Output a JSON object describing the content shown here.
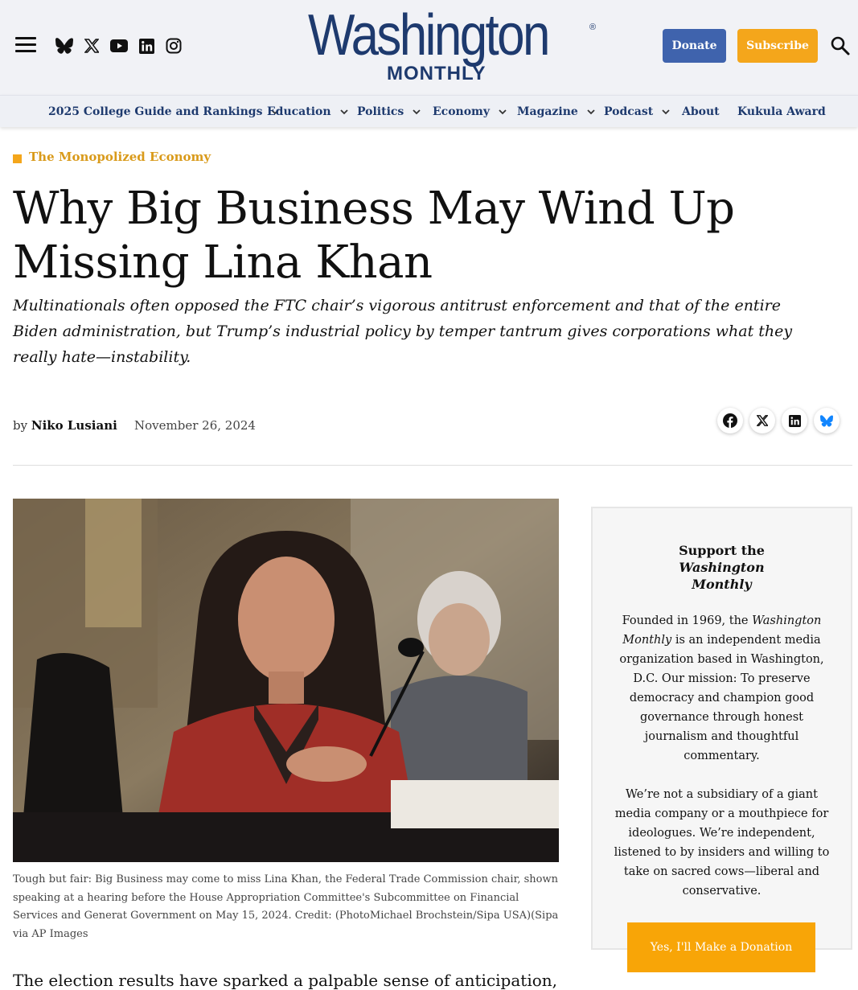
{
  "header": {
    "menu_icon": "hamburger-menu-icon",
    "social_icons": [
      "bluesky-icon",
      "x-icon",
      "youtube-icon",
      "linkedin-icon",
      "instagram-icon"
    ],
    "logo_text": "Washington",
    "logo_reg": "®",
    "logo_sub": "MONTHLY",
    "donate_label": "Donate",
    "subscribe_label": "Subscribe",
    "search_icon": "search-icon"
  },
  "nav": {
    "items": [
      {
        "label": "2025 College Guide and Rankings",
        "has_dropdown": true
      },
      {
        "label": "Education",
        "has_dropdown": true
      },
      {
        "label": "Politics",
        "has_dropdown": true
      },
      {
        "label": "Economy",
        "has_dropdown": true
      },
      {
        "label": "Magazine",
        "has_dropdown": true
      },
      {
        "label": "Podcast",
        "has_dropdown": true
      },
      {
        "label": "About",
        "has_dropdown": false
      },
      {
        "label": "Kukula Award",
        "has_dropdown": false
      }
    ]
  },
  "article": {
    "category": "The Monopolized Economy",
    "title": "Why Big Business May Wind Up Missing Lina Khan",
    "dek": "Multinationals often opposed the FTC chair’s vigorous antitrust enforcement and that of the entire Biden administration, but Trump’s industrial policy by temper tantrum gives corporations what they really hate—instability.",
    "by_prefix": "by",
    "author": "Niko Lusiani",
    "date": "November 26, 2024",
    "share_icons": [
      "facebook-icon",
      "x-icon",
      "linkedin-icon",
      "bluesky-icon"
    ],
    "caption": "Tough but fair: Big Business may come to miss Lina Khan, the Federal Trade Commission chair, shown speaking at a hearing before the House Appropriation Committee's Subcommittee on Financial Services and Generat Government on May 15, 2024. Credit: (PhotoMichael Brochstein/Sipa USA)(Sipa via AP Images",
    "body_start": "The election results have sparked a palpable sense of anticipation, if"
  },
  "sidebar": {
    "title_prefix": "Support the ",
    "title_em": "Washington Monthly",
    "p1_prefix": "Founded in 1969, the ",
    "p1_em": "Washington Monthly",
    "p1_rest": " is an independent media organization based in Washington, D.C. Our mission: To preserve democracy and champion good governance through honest journalism and thoughtful commentary.",
    "p2": "We’re not a subsidiary of a giant media company or a mouthpiece for ideologues. We’re independent, listened to by insiders and willing to take on sacred cows—liberal and conservative.",
    "cta_label": "Yes, I'll Make a Donation"
  },
  "colors": {
    "brand_navy": "#1e3a6e",
    "donate_blue": "#3f63ad",
    "accent_orange": "#f4a61b"
  }
}
